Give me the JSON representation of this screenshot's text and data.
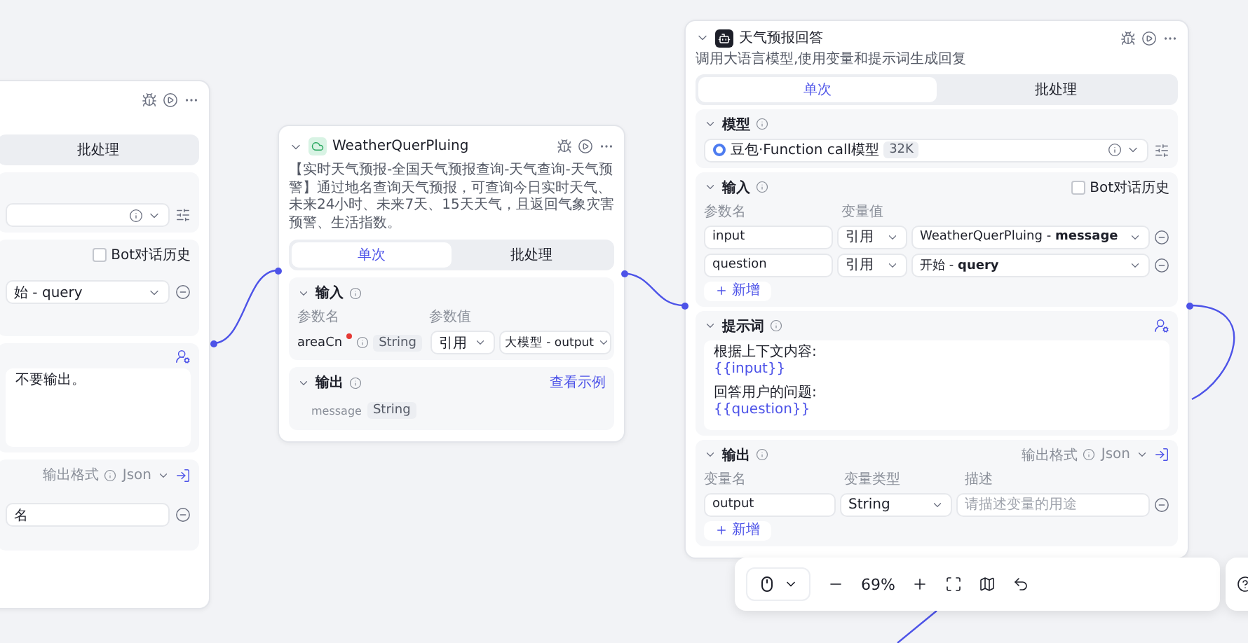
{
  "left_node": {
    "tabs": [
      {
        "label": "批处理",
        "selected": false
      }
    ],
    "history_checkbox": {
      "label": "Bot对话历史",
      "checked": false
    },
    "input_value": "始 - query",
    "prompt_text": "不要输出。",
    "output_format_label": "输出格式",
    "output_format": "Json",
    "output_field": "名"
  },
  "plugin_node": {
    "title": "WeatherQuerPluing",
    "description": "【实时天气预报-全国天气预报查询-天气查询-天气预警】通过地名查询天气预报，可查询今日实时天气、未来24小时、未来7天、15天天气，且返回气象灾害预警、生活指数。",
    "tabs": [
      {
        "label": "单次",
        "selected": true
      },
      {
        "label": "批处理",
        "selected": false
      }
    ],
    "input": {
      "title": "输入",
      "headers": [
        "参数名",
        "参数值"
      ],
      "rows": [
        {
          "name": "areaCn",
          "required": true,
          "type": "String",
          "source": "引用",
          "value": "大模型 - output"
        }
      ]
    },
    "output": {
      "title": "输出",
      "link": "查看示例",
      "rows": [
        {
          "name": "message",
          "type": "String"
        }
      ]
    }
  },
  "llm_node": {
    "title": "天气预报回答",
    "description": "调用大语言模型,使用变量和提示词生成回复",
    "tabs": [
      {
        "label": "单次",
        "selected": true
      },
      {
        "label": "批处理",
        "selected": false
      }
    ],
    "model": {
      "title": "模型",
      "name": "豆包·Function call模型",
      "badge": "32K"
    },
    "input": {
      "title": "输入",
      "history_checkbox": {
        "label": "Bot对话历史",
        "checked": false
      },
      "headers": [
        "参数名",
        "变量值"
      ],
      "rows": [
        {
          "name": "input",
          "source": "引用",
          "node": "WeatherQuerPluing",
          "separator": "-",
          "field": "message"
        },
        {
          "name": "question",
          "source": "引用",
          "node": "开始",
          "separator": "-",
          "field": "query"
        }
      ],
      "add": "新增"
    },
    "prompt": {
      "title": "提示词",
      "lines": [
        {
          "text": "根据上下文内容:",
          "kind": "text"
        },
        {
          "text": "{{input}}",
          "kind": "variable"
        },
        {
          "text": "回答用户的问题:",
          "kind": "text"
        },
        {
          "text": "{{question}}",
          "kind": "variable"
        }
      ]
    },
    "output": {
      "title": "输出",
      "format_label": "输出格式",
      "format": "Json",
      "headers": [
        "变量名",
        "变量类型",
        "描述"
      ],
      "rows": [
        {
          "name": "output",
          "type": "String",
          "placeholder": "请描述变量的用途"
        }
      ],
      "add": "新增"
    }
  },
  "toolbar": {
    "zoom": "69%"
  }
}
